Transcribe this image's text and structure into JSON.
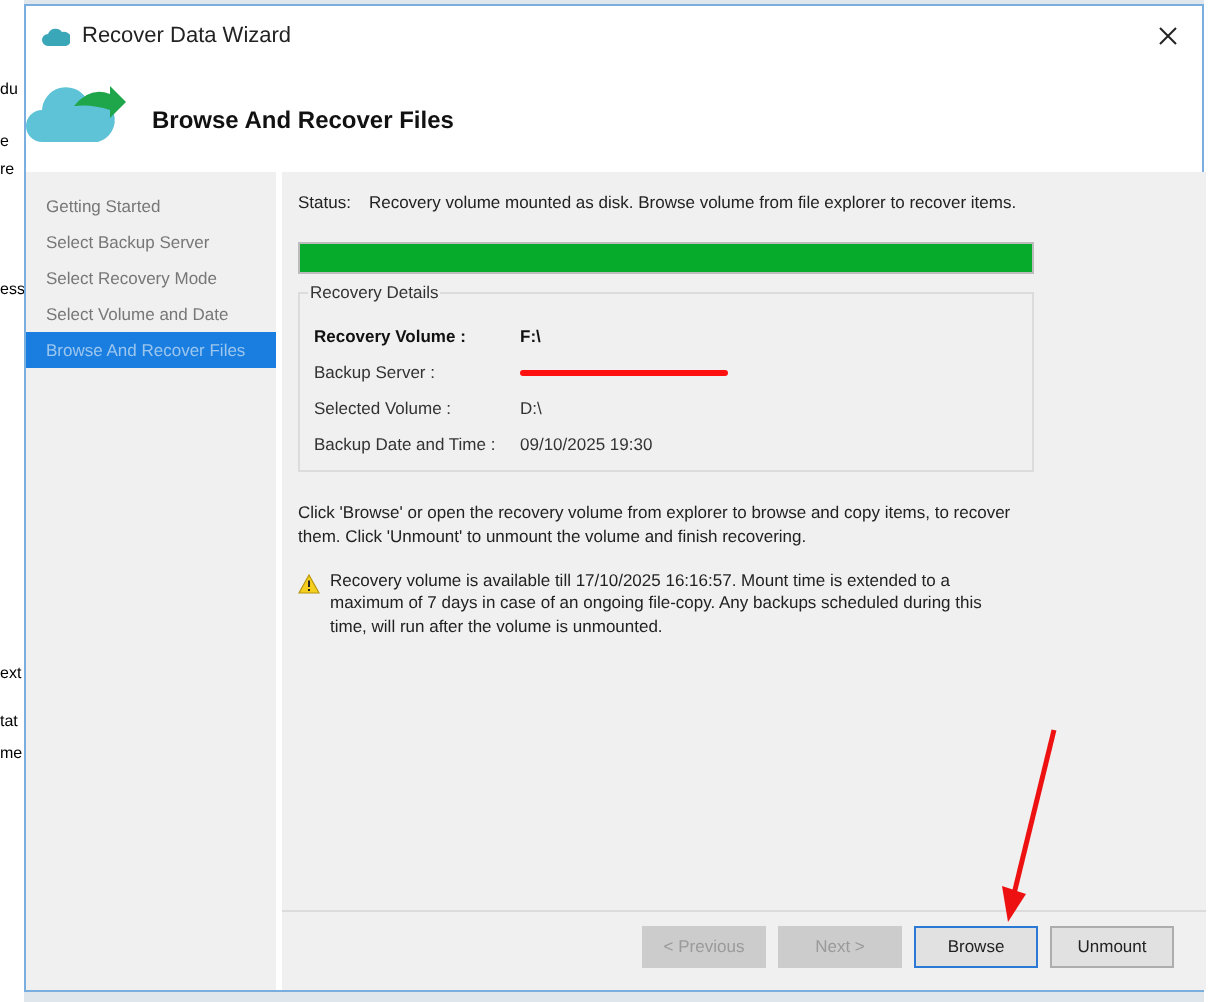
{
  "background_window": {
    "fragments": [
      "du",
      "e",
      "re",
      "ess",
      "ext",
      "tat",
      "me"
    ]
  },
  "window": {
    "title": "Recover Data Wizard",
    "heading": "Browse And Recover Files"
  },
  "steps": [
    {
      "label": "Getting Started",
      "selected": false
    },
    {
      "label": "Select Backup Server",
      "selected": false
    },
    {
      "label": "Select Recovery Mode",
      "selected": false
    },
    {
      "label": "Select Volume and Date",
      "selected": false
    },
    {
      "label": "Browse And Recover Files",
      "selected": true
    }
  ],
  "status": {
    "label": "Status:",
    "text": "Recovery volume mounted as disk. Browse volume from file explorer to recover items.",
    "level": 1
  },
  "details": {
    "title": "Recovery Details",
    "rows": [
      {
        "label": "Recovery Volume :",
        "value": "F:\\",
        "kind": "bold"
      },
      {
        "label": "Backup Server :",
        "kind": "redacted"
      },
      {
        "label": "Selected Volume :",
        "value": "D:\\",
        "kind": "plain"
      },
      {
        "label": "Backup Date and Time :",
        "value": "09/10/2025 19:30",
        "kind": "plain"
      }
    ]
  },
  "instructions": "Click 'Browse' or open the recovery volume from explorer to browse and copy items, to recover them. Click 'Unmount' to unmount the volume and finish recovering.",
  "warning": "Recovery volume is available till 17/10/2025 16:16:57. Mount time is extended to a maximum of 7 days in case of an ongoing file-copy. Any backups scheduled during this time, will run after the volume is unmounted.",
  "buttons": [
    {
      "label": "< Previous",
      "disabled": true,
      "selected": false
    },
    {
      "label": "Next >",
      "disabled": true,
      "selected": false
    },
    {
      "label": "Browse",
      "disabled": false,
      "selected": true
    },
    {
      "label": "Unmount",
      "disabled": false,
      "selected": false
    }
  ]
}
